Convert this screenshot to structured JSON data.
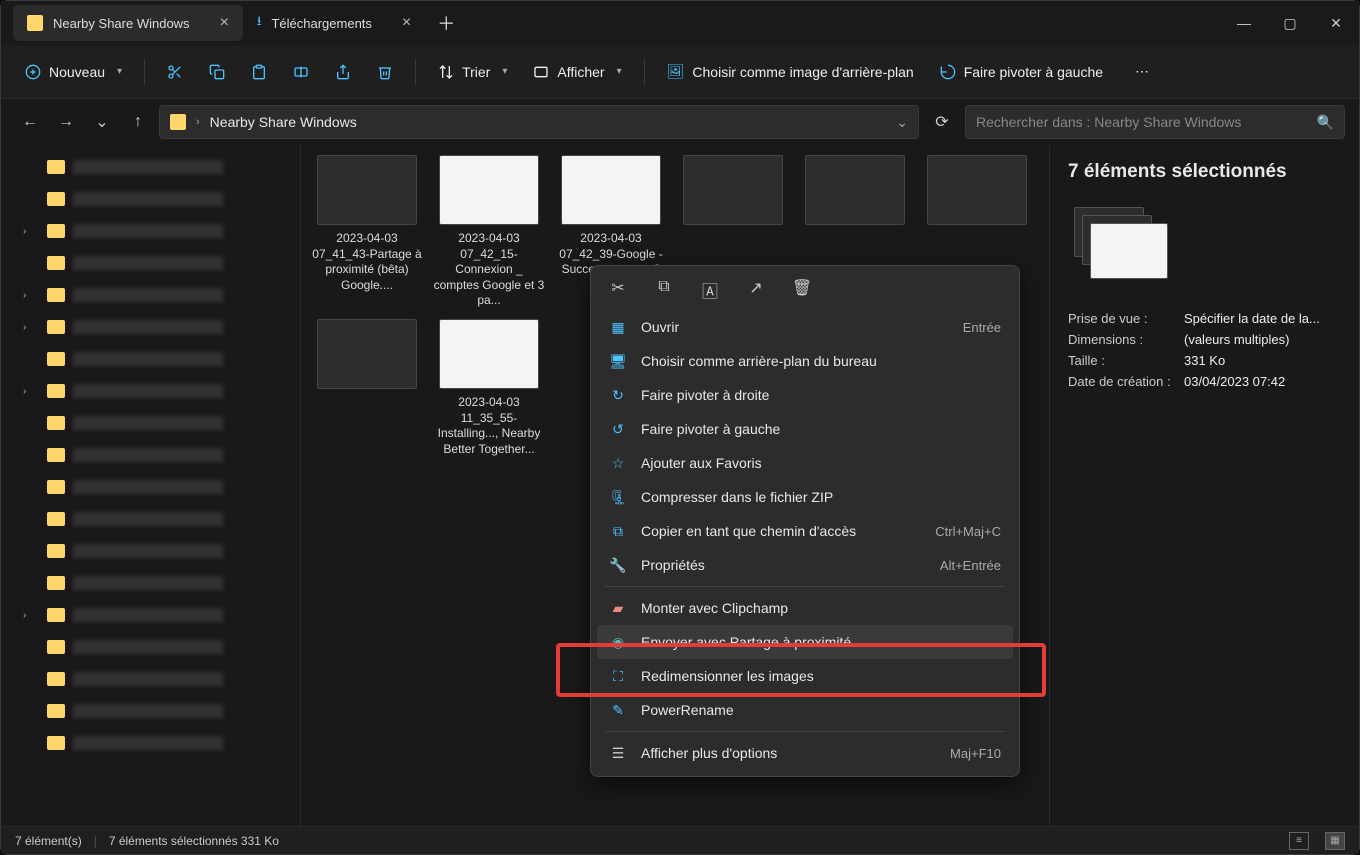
{
  "tabs": {
    "active": "Nearby Share Windows",
    "second": "Téléchargements"
  },
  "toolbar": {
    "new_label": "Nouveau",
    "sort_label": "Trier",
    "view_label": "Afficher",
    "set_bg_label": "Choisir comme image d'arrière-plan",
    "rotate_left_label": "Faire pivoter à gauche"
  },
  "breadcrumb": {
    "path": "Nearby Share Windows"
  },
  "search": {
    "placeholder": "Rechercher dans : Nearby Share Windows"
  },
  "files": [
    {
      "name": "2023-04-03 07_41_43-Partage à proximité (bêta) Google...."
    },
    {
      "name": "2023-04-03 07_42_15-Connexion _ comptes Google et 3 pa..."
    },
    {
      "name": "2023-04-03 07_42_39-Google - Success page et 3 p..."
    },
    {
      "name": ""
    },
    {
      "name": ""
    },
    {
      "name": ""
    },
    {
      "name": ""
    },
    {
      "name": "2023-04-03 11_35_55-Installing..., Nearby Better Together..."
    }
  ],
  "context_menu": {
    "open": "Ouvrir",
    "open_shortcut": "Entrée",
    "set_desktop_bg": "Choisir comme arrière-plan du bureau",
    "rotate_right": "Faire pivoter à droite",
    "rotate_left": "Faire pivoter à gauche",
    "add_fav": "Ajouter aux Favoris",
    "zip": "Compresser dans le fichier ZIP",
    "copy_path": "Copier en tant que chemin d'accès",
    "copy_path_shortcut": "Ctrl+Maj+C",
    "properties": "Propriétés",
    "properties_shortcut": "Alt+Entrée",
    "clipchamp": "Monter avec Clipchamp",
    "nearby_share": "Envoyer avec Partage à proximité",
    "resize": "Redimensionner les images",
    "powerrename": "PowerRename",
    "more": "Afficher plus d'options",
    "more_shortcut": "Maj+F10"
  },
  "details": {
    "title": "7 éléments sélectionnés",
    "shot_date_label": "Prise de vue :",
    "shot_date_value": "Spécifier la date de la...",
    "dimensions_label": "Dimensions :",
    "dimensions_value": "(valeurs multiples)",
    "size_label": "Taille :",
    "size_value": "331 Ko",
    "created_label": "Date de création :",
    "created_value": "03/04/2023 07:42"
  },
  "statusbar": {
    "count": "7 élément(s)",
    "selected": "7 éléments sélectionnés  331 Ko"
  }
}
